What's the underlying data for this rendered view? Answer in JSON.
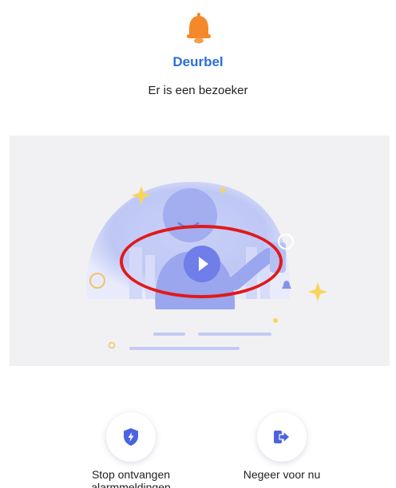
{
  "header": {
    "icon": "bell-icon",
    "title": "Deurbel",
    "subtitle": "Er is een bezoeker"
  },
  "video": {
    "play_icon": "play-icon",
    "highlight_color": "#e01a1a"
  },
  "actions": [
    {
      "icon": "shield-bolt-icon",
      "label_line1": "Stop ontvangen",
      "label_line2": "alarmmeldingen"
    },
    {
      "icon": "exit-arrow-icon",
      "label_line1": "Negeer voor nu"
    }
  ],
  "colors": {
    "accent": "#2a6fdb",
    "bell": "#f5882b",
    "play": "#6f7ee8",
    "icon_blue": "#4a63e0"
  }
}
